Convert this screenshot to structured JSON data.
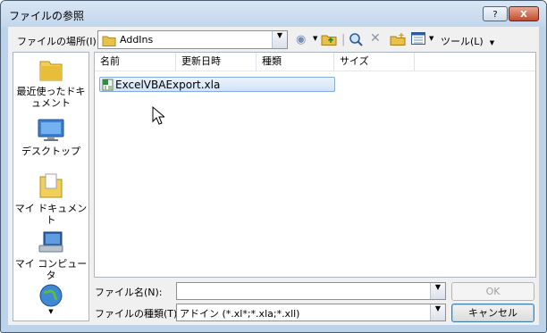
{
  "window": {
    "title": "ファイルの参照",
    "help_glyph": "?",
    "close_glyph": "X"
  },
  "lookin": {
    "label": "ファイルの場所(I):",
    "value": "AddIns"
  },
  "toolbar": {
    "tools_label": "ツール(L)"
  },
  "places": [
    {
      "label": "最近使ったドキュメント",
      "icon": "recent-folder-icon"
    },
    {
      "label": "デスクトップ",
      "icon": "desktop-icon"
    },
    {
      "label": "マイ ドキュメント",
      "icon": "my-documents-icon"
    },
    {
      "label": "マイ コンピュータ",
      "icon": "my-computer-icon"
    },
    {
      "label": "",
      "icon": "network-globe-icon"
    }
  ],
  "columns": [
    "名前",
    "更新日時",
    "種類",
    "サイズ"
  ],
  "files": [
    {
      "name": "ExcelVBAExport.xla",
      "selected": true,
      "icon": "excel-addin-icon"
    }
  ],
  "filename": {
    "label": "ファイル名(N):",
    "value": ""
  },
  "filetype": {
    "label": "ファイルの種類(T):",
    "value": "アドイン (*.xl*;*.xla;*.xll)"
  },
  "buttons": {
    "ok": "OK",
    "cancel": "キャンセル"
  }
}
